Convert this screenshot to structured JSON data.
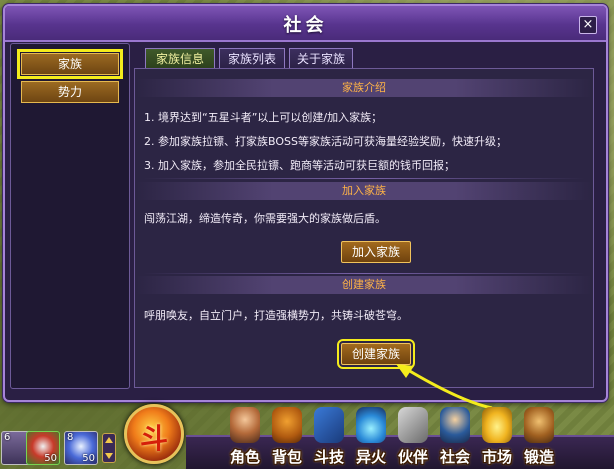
{
  "window": {
    "title": "社会",
    "close_label": "×"
  },
  "sidebar": {
    "items": [
      {
        "label": "家族",
        "active": true
      },
      {
        "label": "势力",
        "active": false
      }
    ]
  },
  "tabs": [
    {
      "label": "家族信息",
      "active": true
    },
    {
      "label": "家族列表",
      "active": false
    },
    {
      "label": "关于家族",
      "active": false
    }
  ],
  "intro": {
    "heading": "家族介绍",
    "lines": [
      "1. 境界达到“五星斗者”以上可以创建/加入家族；",
      "2. 参加家族拉镖、打家族BOSS等家族活动可获海量经验奖励，快速升级；",
      "3. 加入家族，参加全民拉镖、跑商等活动可获巨额的钱币回报；"
    ]
  },
  "join": {
    "heading": "加入家族",
    "text": "闯荡江湖，缔造传奇，你需要强大的家族做后盾。",
    "button_label": "加入家族"
  },
  "create": {
    "heading": "创建家族",
    "text": "呼朋唤友，自立门户，打造强横势力，共铸斗破苍穹。",
    "button_label": "创建家族"
  },
  "hud": {
    "orb_label": "斗",
    "slots": [
      {
        "num": "6",
        "count": ""
      },
      {
        "num": "",
        "count": "50"
      },
      {
        "num": "8",
        "count": "50"
      }
    ],
    "menu": [
      {
        "label": "角色",
        "icon": "character-icon"
      },
      {
        "label": "背包",
        "icon": "bag-icon"
      },
      {
        "label": "斗技",
        "icon": "skill-book-icon"
      },
      {
        "label": "异火",
        "icon": "flame-icon"
      },
      {
        "label": "伙伴",
        "icon": "partner-icon"
      },
      {
        "label": "社会",
        "icon": "society-icon"
      },
      {
        "label": "市场",
        "icon": "ingot-icon"
      },
      {
        "label": "锻造",
        "icon": "anvil-icon"
      }
    ]
  },
  "colors": {
    "accent_yellow": "#f4ec1c",
    "button_gold": "#a26a1e",
    "heading_orange": "#ffb347",
    "window_purple": "#58348e"
  }
}
